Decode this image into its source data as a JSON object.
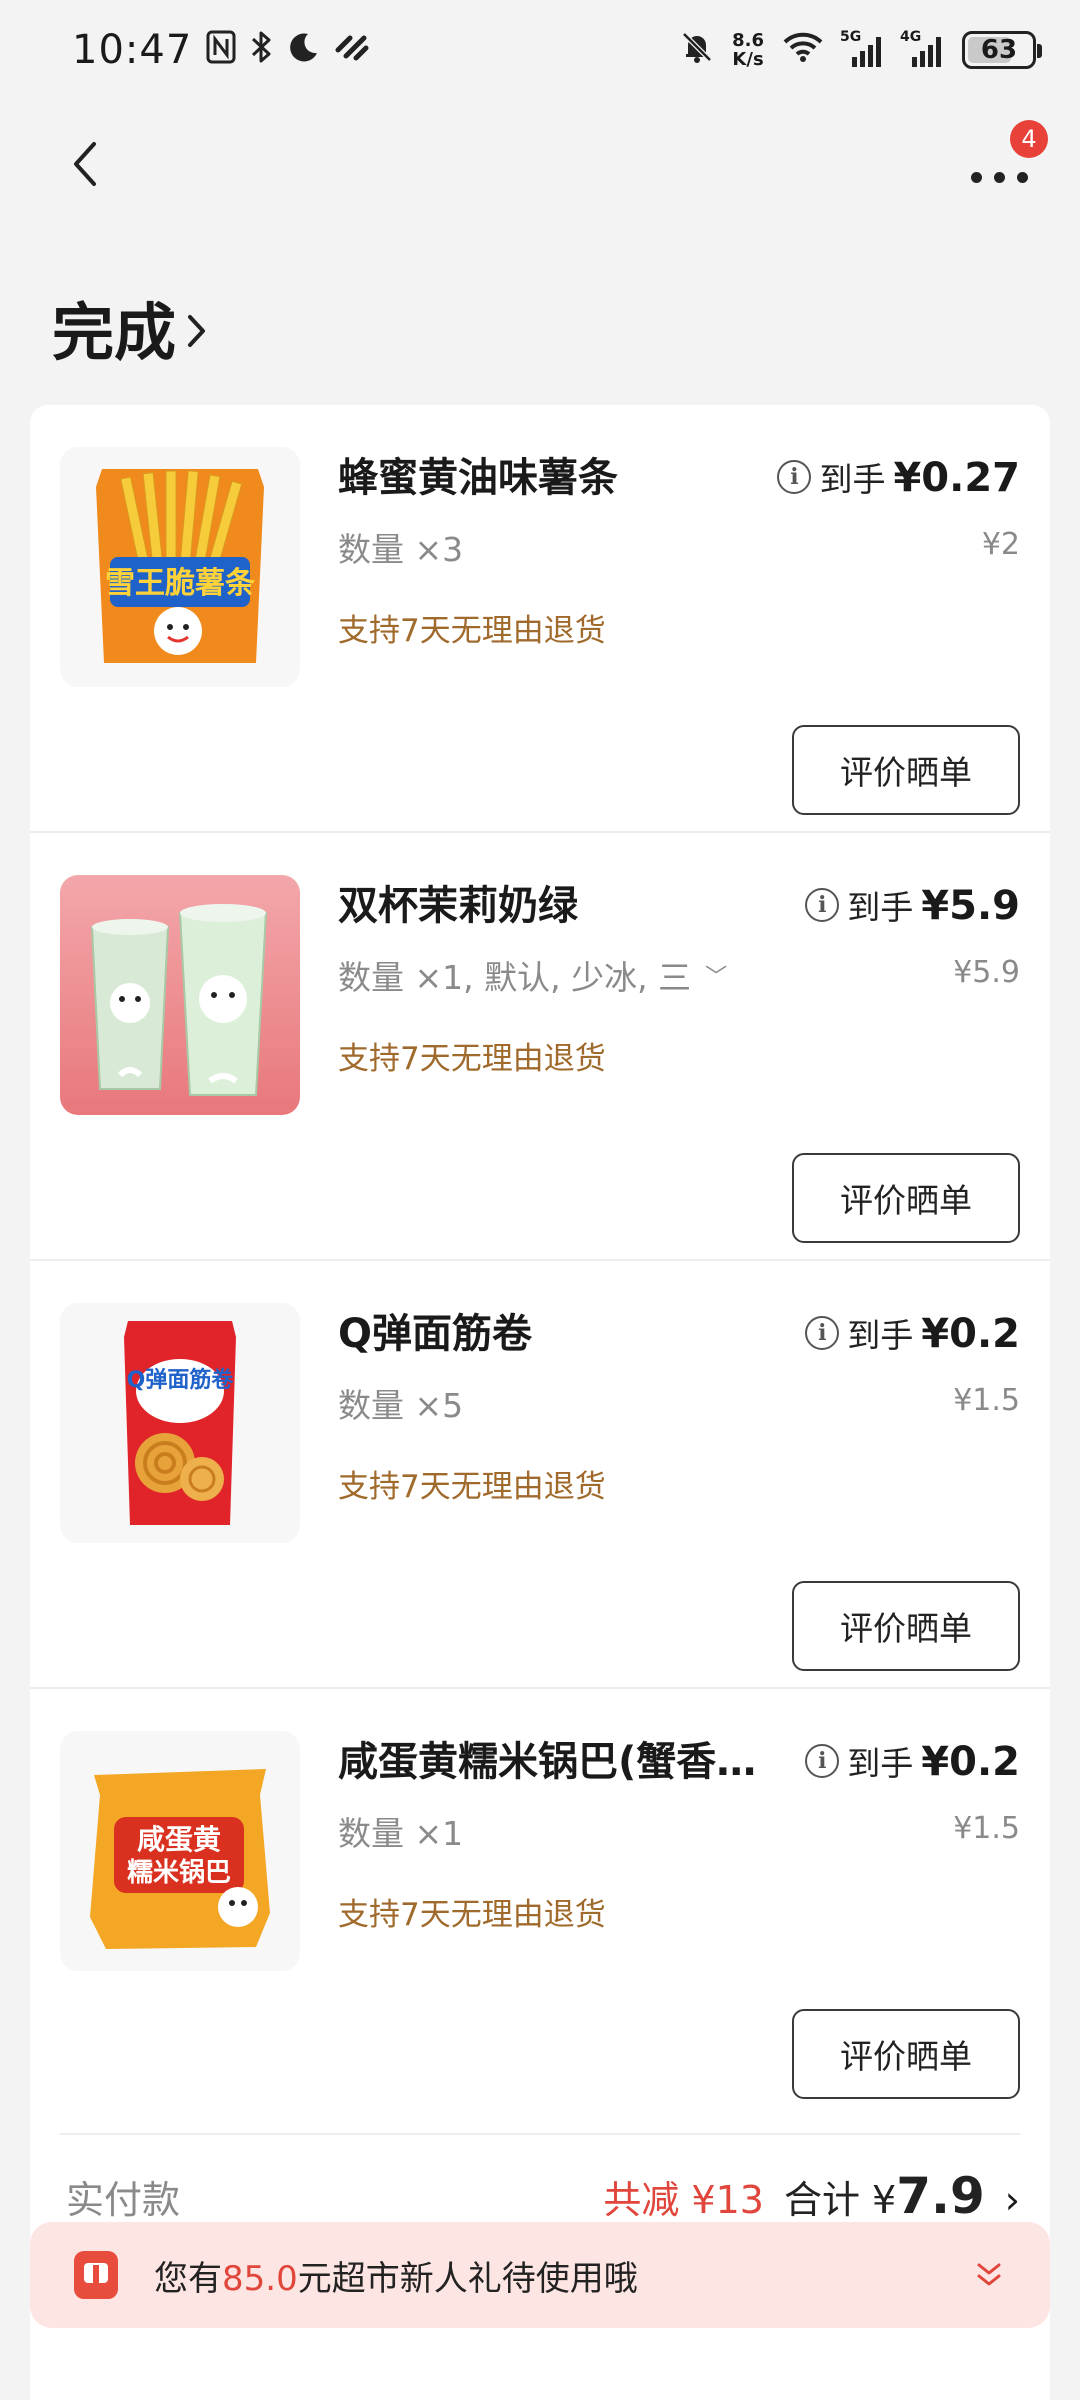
{
  "status_bar": {
    "time": "10:47",
    "net_speed_value": "8.6",
    "net_speed_unit": "K/s",
    "signal_1": "5G",
    "signal_2": "4G",
    "battery": "63"
  },
  "nav": {
    "badge": "4"
  },
  "order": {
    "status": "完成"
  },
  "items": [
    {
      "name": "蜂蜜黄油味薯条",
      "qty": "数量 ×3",
      "policy": "支持7天无理由退货",
      "price_label": "到手",
      "price": "¥0.27",
      "orig_price": "¥2",
      "review": "评价晒单",
      "thumb_text": "雪王脆薯条"
    },
    {
      "name": "双杯茉莉奶绿",
      "qty": "数量 ×1, 默认, 少冰, 三",
      "policy": "支持7天无理由退货",
      "price_label": "到手",
      "price": "¥5.9",
      "orig_price": "¥5.9",
      "review": "评价晒单"
    },
    {
      "name": "Q弹面筋卷",
      "qty": "数量 ×5",
      "policy": "支持7天无理由退货",
      "price_label": "到手",
      "price": "¥0.2",
      "orig_price": "¥1.5",
      "review": "评价晒单",
      "thumb_text": "Q弹面筋卷"
    },
    {
      "name": "咸蛋黄糯米锅巴(蟹香…",
      "qty": "数量 ×1",
      "policy": "支持7天无理由退货",
      "price_label": "到手",
      "price": "¥0.2",
      "orig_price": "¥1.5",
      "review": "评价晒单",
      "thumb_text_1": "咸蛋黄",
      "thumb_text_2": "糯米锅巴"
    }
  ],
  "summary": {
    "paid_label": "实付款",
    "discount": "共减 ¥13",
    "total_label": "合计 ¥",
    "total_value": "7.9"
  },
  "banner": {
    "prefix": "您有",
    "amount": "85.0",
    "suffix": "元超市新人礼待使用哦"
  },
  "colors": {
    "accent_red": "#e0463b",
    "policy_brown": "#a06a2c",
    "badge_red": "#e8413a",
    "banner_bg": "#fde5e3"
  }
}
